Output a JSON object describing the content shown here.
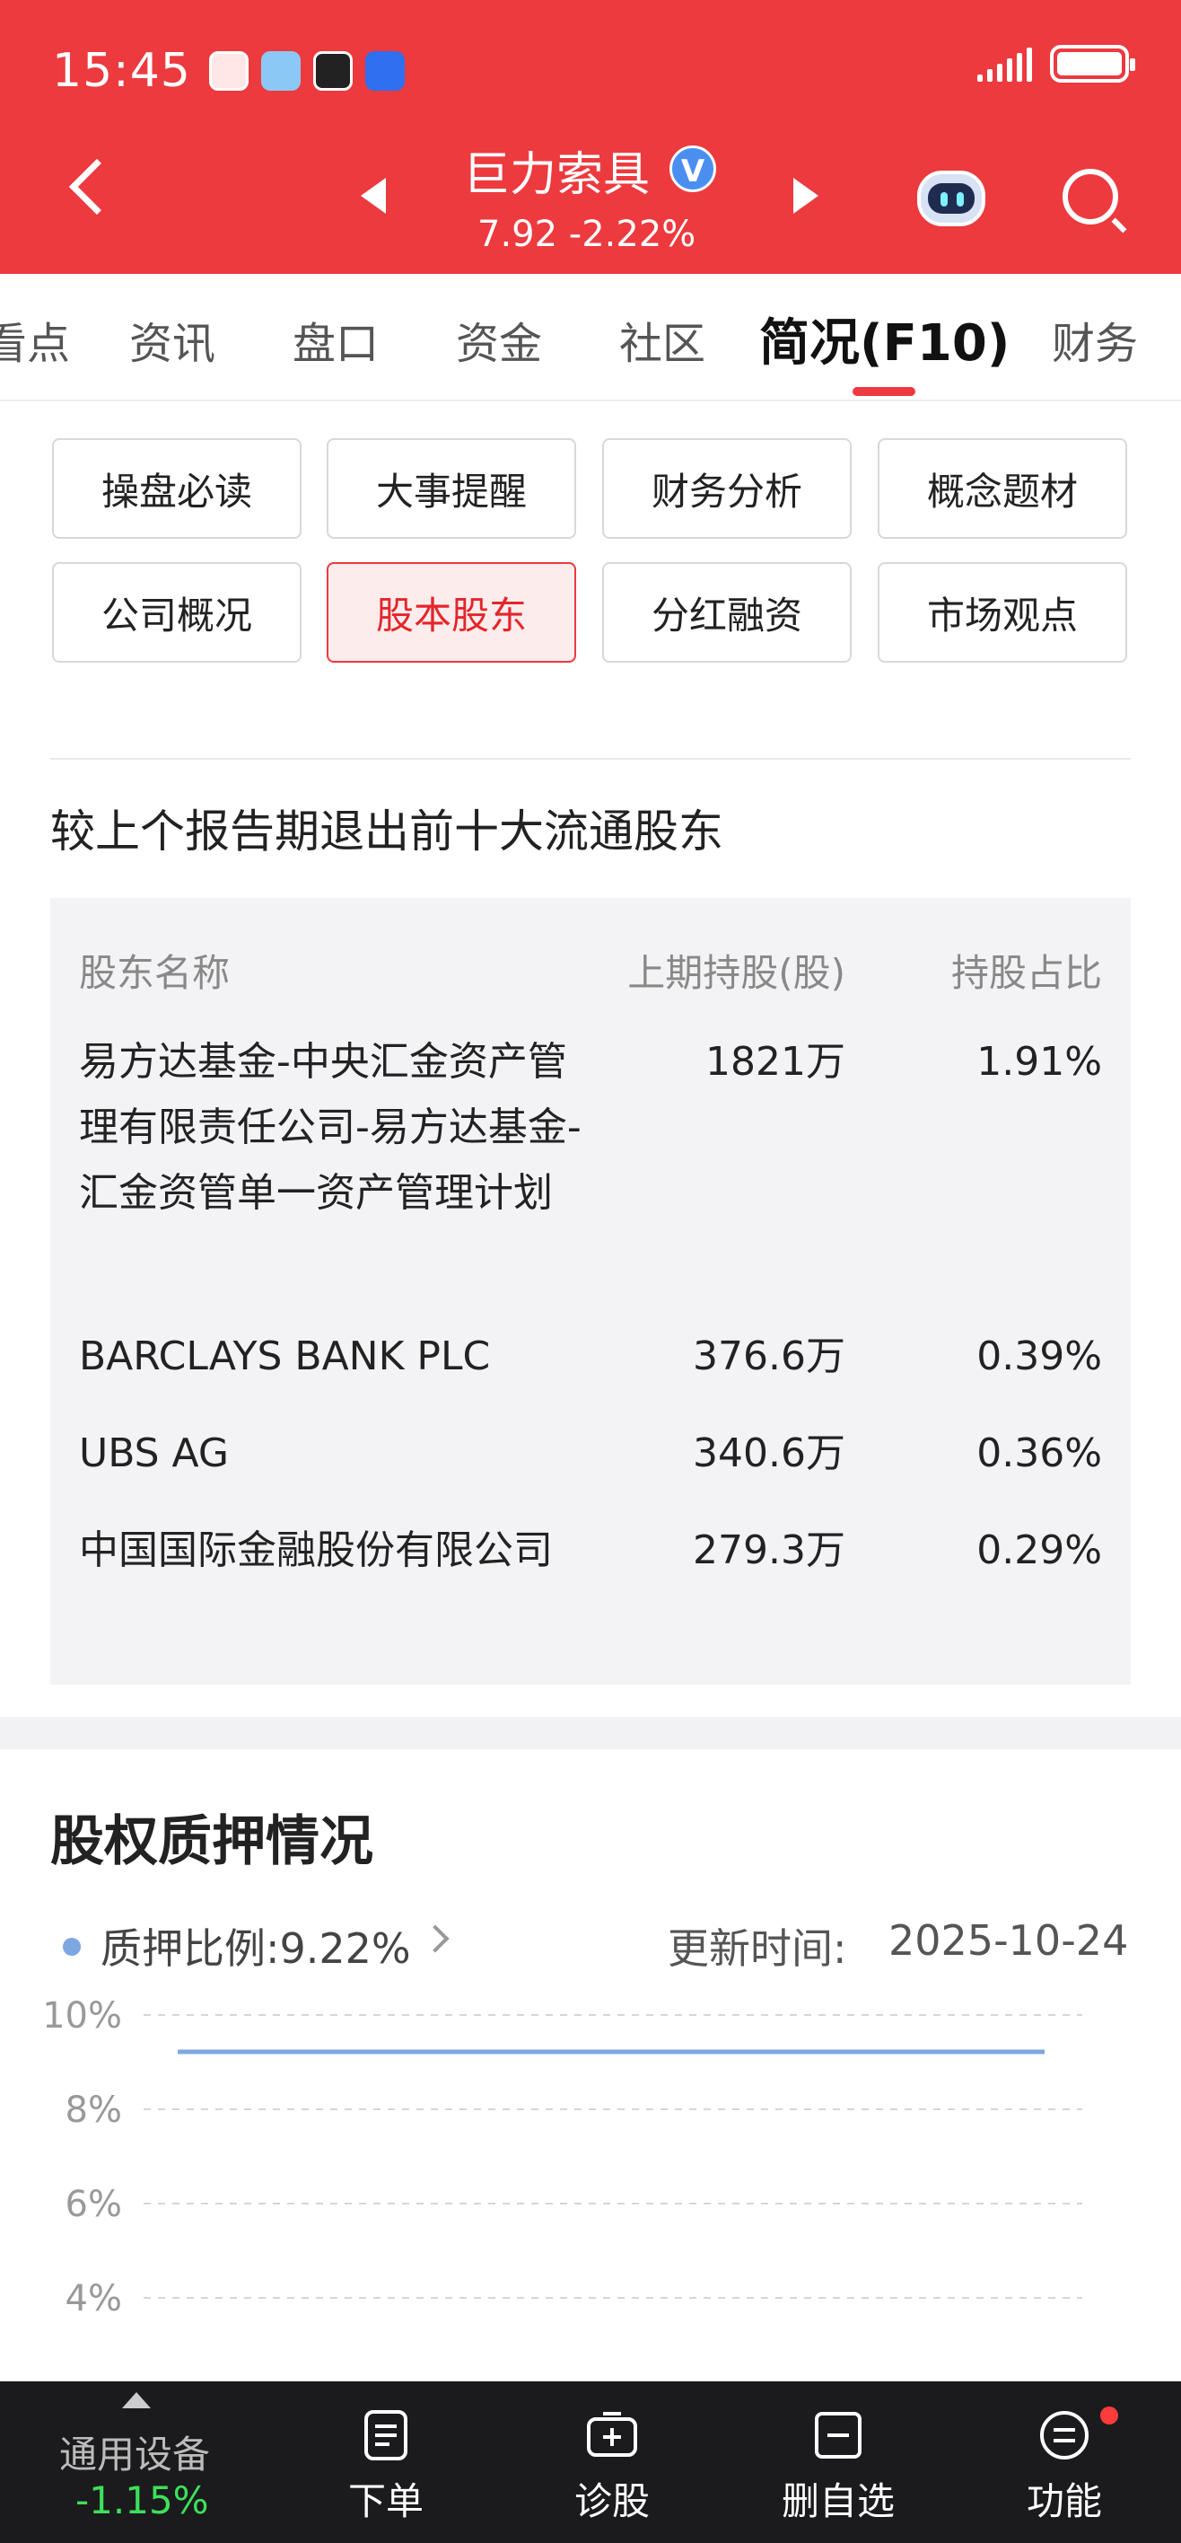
{
  "status_bar": {
    "time": "15:45"
  },
  "stock": {
    "name": "巨力索具",
    "verified_mark": "V",
    "price_line": "7.92 -2.22%"
  },
  "tabs": [
    "看点",
    "资讯",
    "盘口",
    "资金",
    "社区",
    "简况(F10)",
    "财务"
  ],
  "sub_buttons": [
    "操盘必读",
    "大事提醒",
    "财务分析",
    "概念题材",
    "公司概况",
    "股本股东",
    "分红融资",
    "市场观点"
  ],
  "active_sub": "股本股东",
  "section": {
    "title": "较上个报告期退出前十大流通股东",
    "headers": {
      "name": "股东名称",
      "shares": "上期持股(股)",
      "ratio": "持股占比"
    },
    "rows": [
      {
        "name": "易方达基金-中央汇金资产管理有限责任公司-易方达基金-汇金资管单一资产管理计划",
        "shares": "1821万",
        "ratio": "1.91%"
      },
      {
        "name": "BARCLAYS BANK PLC",
        "shares": "376.6万",
        "ratio": "0.39%"
      },
      {
        "name": "UBS AG",
        "shares": "340.6万",
        "ratio": "0.36%"
      },
      {
        "name": "中国国际金融股份有限公司",
        "shares": "279.3万",
        "ratio": "0.29%"
      }
    ]
  },
  "pledge": {
    "title": "股权质押情况",
    "legend": "质押比例:9.22%",
    "update_label": "更新时间:",
    "update_date": "2025-10-24"
  },
  "chart_data": {
    "type": "line",
    "y_ticks": [
      "10%",
      "8%",
      "6%",
      "4%"
    ],
    "ylim": [
      4,
      10
    ],
    "series": [
      {
        "name": "质押比例",
        "values": [
          9.22,
          9.22
        ]
      }
    ],
    "color": "#7da7e0",
    "grid": true
  },
  "bottom_bar": {
    "stock_name": "通用设备",
    "stock_change": "-1.15%",
    "items": [
      "下单",
      "诊股",
      "删自选",
      "功能"
    ]
  },
  "colors": {
    "accent": "#ec3a3f",
    "up": "#e3262c",
    "down": "#3de05a",
    "line": "#7da7e0"
  }
}
